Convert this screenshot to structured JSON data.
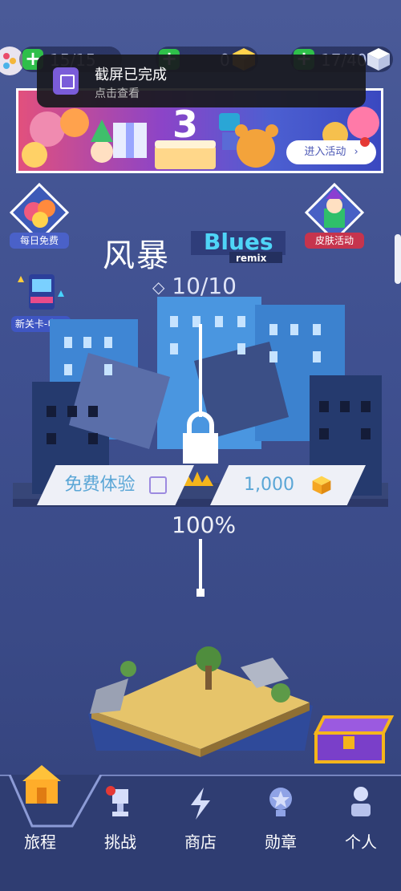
{
  "resources": {
    "energy": "15/15",
    "gold": "0",
    "tickets": "17/40"
  },
  "notification": {
    "title": "截屏已完成",
    "subtitle": "点击查看"
  },
  "banner": {
    "button_label": "进入活动"
  },
  "side_badges": {
    "daily_free": "每日免费",
    "skin_event": "皮肤活动",
    "new_level": "新关卡-电玩"
  },
  "level": {
    "title": "风暴",
    "logo_main": "Blues",
    "logo_sub": "remix",
    "gems": "10/10",
    "progress": "100%",
    "free_trial_label": "免费体验",
    "price": "1,000"
  },
  "tabs": [
    {
      "label": "旅程"
    },
    {
      "label": "挑战"
    },
    {
      "label": "商店"
    },
    {
      "label": "勋章"
    },
    {
      "label": "个人"
    }
  ],
  "colors": {
    "background": "#3f5090",
    "accent_green": "#2fbf4a",
    "gold": "#f5b51b",
    "tab_bar": "#2f3d72",
    "price_text": "#5aa6d6"
  }
}
